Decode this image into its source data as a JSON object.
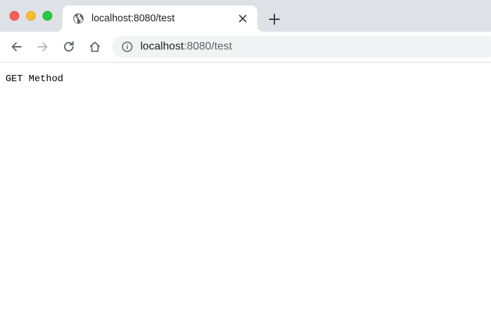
{
  "window": {
    "traffic_lights": {
      "close_color": "#fe5f57",
      "minimize_color": "#febc2e",
      "maximize_color": "#28c840"
    }
  },
  "tab": {
    "title": "localhost:8080/test",
    "favicon": "globe-icon",
    "close_icon": "close-icon"
  },
  "new_tab_icon": "plus-icon",
  "toolbar": {
    "back_icon": "arrow-left-icon",
    "forward_icon": "arrow-right-icon",
    "reload_icon": "reload-icon",
    "home_icon": "home-icon"
  },
  "address_bar": {
    "security_icon": "info-icon",
    "url_host": "localhost",
    "url_rest": ":8080/test"
  },
  "page": {
    "body_text": "GET Method"
  }
}
